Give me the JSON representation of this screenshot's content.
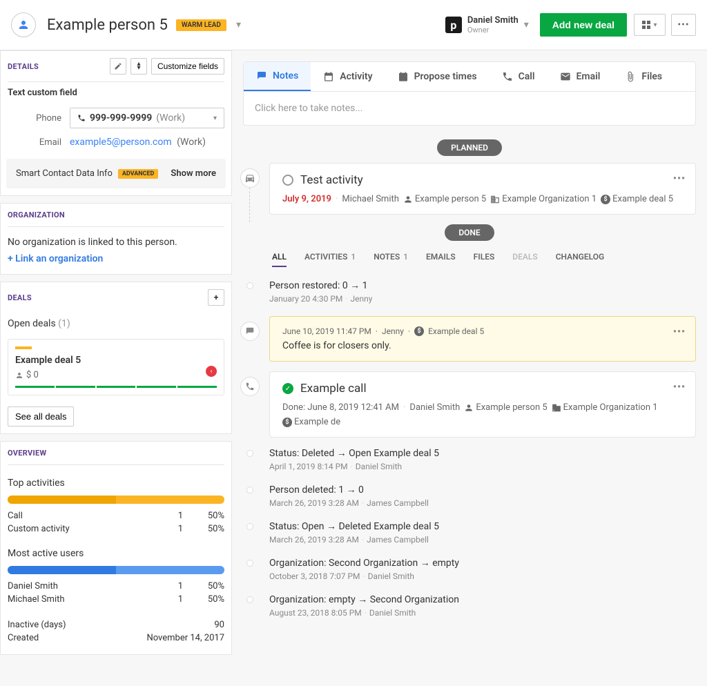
{
  "header": {
    "person_name": "Example person 5",
    "lead_badge": "WARM LEAD",
    "owner_name": "Daniel Smith",
    "owner_role": "Owner",
    "add_deal": "Add new deal"
  },
  "details": {
    "title": "DETAILS",
    "customize": "Customize fields",
    "custom_field_label": "Text custom field",
    "phone_label": "Phone",
    "phone_value": "999-999-9999",
    "phone_type": "(Work)",
    "email_label": "Email",
    "email_value": "example5@person.com",
    "email_type": "(Work)",
    "smart_label": "Smart Contact Data Info",
    "advanced": "ADVANCED",
    "show_more": "Show more"
  },
  "organization": {
    "title": "ORGANIZATION",
    "no_org": "No organization is linked to this person.",
    "link": "+ Link an organization"
  },
  "deals": {
    "title": "DEALS",
    "open_label": "Open deals",
    "open_count": "(1)",
    "deal_name": "Example deal 5",
    "deal_amount": "$ 0",
    "see_all": "See all deals"
  },
  "overview": {
    "title": "OVERVIEW",
    "top_activities": "Top activities",
    "rows_activities": [
      {
        "label": "Call",
        "num": "1",
        "pct": "50%"
      },
      {
        "label": "Custom activity",
        "num": "1",
        "pct": "50%"
      }
    ],
    "most_active": "Most active users",
    "rows_users": [
      {
        "label": "Daniel Smith",
        "num": "1",
        "pct": "50%"
      },
      {
        "label": "Michael Smith",
        "num": "1",
        "pct": "50%"
      }
    ],
    "inactive_label": "Inactive (days)",
    "inactive_val": "90",
    "created_label": "Created",
    "created_val": "November 14, 2017"
  },
  "tabs": {
    "notes": "Notes",
    "activity": "Activity",
    "propose": "Propose times",
    "call": "Call",
    "email": "Email",
    "files": "Files",
    "placeholder": "Click here to take notes..."
  },
  "planned": "PLANNED",
  "done": "DONE",
  "activity1": {
    "title": "Test activity",
    "date": "July 9, 2019",
    "author": "Michael Smith",
    "person": "Example person 5",
    "org": "Example Organization 1",
    "deal": "Example deal 5"
  },
  "filters": {
    "all": "ALL",
    "activities": "ACTIVITIES",
    "activities_n": "1",
    "notes": "NOTES",
    "notes_n": "1",
    "emails": "EMAILS",
    "files": "FILES",
    "deals": "DEALS",
    "changelog": "CHANGELOG"
  },
  "log1": {
    "title": "Person restored: 0 → 1",
    "date": "January 20 4:30 PM",
    "author": "Jenny"
  },
  "note1": {
    "date": "June 10, 2019 11:47 PM",
    "author": "Jenny",
    "deal": "Example deal 5",
    "body": "Coffee is for closers only."
  },
  "call1": {
    "title": "Example call",
    "meta": "Done: June 8, 2019 12:41 AM",
    "author": "Daniel Smith",
    "person": "Example person 5",
    "org": "Example Organization 1",
    "deal": "Example de"
  },
  "log2": {
    "title": "Status: Deleted → Open  Example deal 5",
    "date": "April 1, 2019 8:14 PM",
    "author": "Daniel Smith"
  },
  "log3": {
    "title": "Person deleted: 1 → 0",
    "date": "March 26, 2019 3:28 AM",
    "author": "James Campbell"
  },
  "log4": {
    "title": "Status: Open → Deleted  Example deal 5",
    "date": "March 26, 2019 3:28 AM",
    "author": "James Campbell"
  },
  "log5": {
    "title": "Organization: Second Organization → empty",
    "date": "October 3, 2018 7:07 PM",
    "author": "Daniel Smith"
  },
  "log6": {
    "title": "Organization: empty → Second Organization",
    "date": "August 23, 2018 8:05 PM",
    "author": "Daniel Smith"
  }
}
